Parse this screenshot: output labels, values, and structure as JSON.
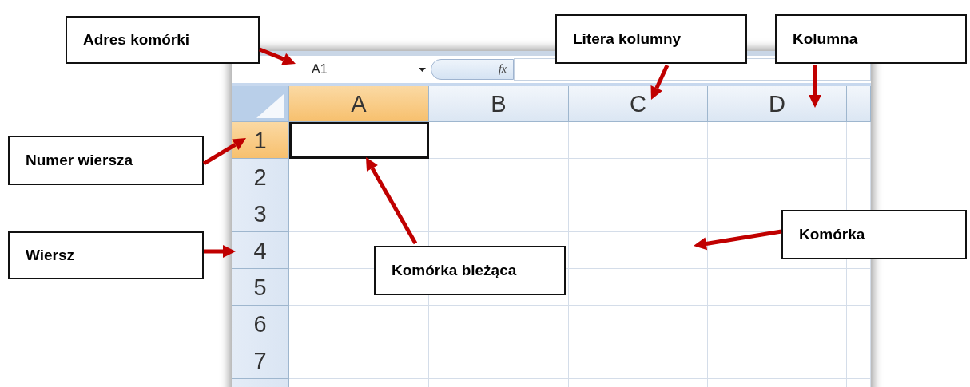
{
  "formula_bar": {
    "name_box": "A1",
    "function_label": "fx"
  },
  "columns": [
    {
      "label": "A",
      "selected": true
    },
    {
      "label": "B",
      "selected": false
    },
    {
      "label": "C",
      "selected": false
    },
    {
      "label": "D",
      "selected": false
    }
  ],
  "rows": [
    {
      "label": "1",
      "selected": true
    },
    {
      "label": "2",
      "selected": false
    },
    {
      "label": "3",
      "selected": false
    },
    {
      "label": "4",
      "selected": false
    },
    {
      "label": "5",
      "selected": false
    },
    {
      "label": "6",
      "selected": false
    },
    {
      "label": "7",
      "selected": false
    }
  ],
  "callouts": [
    {
      "label": "Adres komórki"
    },
    {
      "label": "Litera kolumny"
    },
    {
      "label": "Kolumna"
    },
    {
      "label": "Numer wiersza"
    },
    {
      "label": "Wiersz"
    },
    {
      "label": "Komórka bieżąca"
    },
    {
      "label": "Komórka"
    }
  ]
}
